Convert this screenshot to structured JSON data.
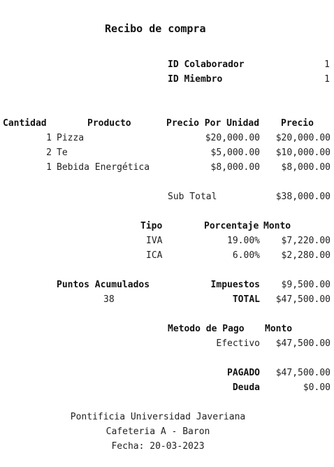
{
  "receipt": {
    "title": "Recibo de compra",
    "ids": [
      {
        "label": "ID Colaborador",
        "value": "1"
      },
      {
        "label": "ID Miembro",
        "value": "1"
      }
    ],
    "items_header": {
      "qty": "Cantidad",
      "product": "Producto",
      "unit_price": "Precio Por Unidad",
      "price": "Precio"
    },
    "items": [
      {
        "qty": "1",
        "product": "Pizza",
        "unit_price": "$20,000.00",
        "price": "$20,000.00"
      },
      {
        "qty": "2",
        "product": "Te",
        "unit_price": "$5,000.00",
        "price": "$10,000.00"
      },
      {
        "qty": "1",
        "product": "Bebida Energética",
        "unit_price": "$8,000.00",
        "price": "$8,000.00"
      }
    ],
    "subtotal": {
      "label": "Sub Total",
      "value": "$38,000.00"
    },
    "tax_header": {
      "type": "Tipo",
      "percent": "Porcentaje",
      "amount": "Monto"
    },
    "taxes": [
      {
        "type": "IVA",
        "percent": "19.00%",
        "amount": "$7,220.00"
      },
      {
        "type": "ICA",
        "percent": "6.00%",
        "amount": "$2,280.00"
      }
    ],
    "points": {
      "label": "Puntos Acumulados",
      "value": "38"
    },
    "taxes_total": {
      "label": "Impuestos",
      "value": "$9,500.00"
    },
    "total": {
      "label": "TOTAL",
      "value": "$47,500.00"
    },
    "payment_header": {
      "method": "Metodo de Pago",
      "amount": "Monto"
    },
    "payment": {
      "method": "Efectivo",
      "amount": "$47,500.00"
    },
    "paid": {
      "label": "PAGADO",
      "value": "$47,500.00"
    },
    "debt": {
      "label": "Deuda",
      "value": "$0.00"
    },
    "footer": {
      "university": "Pontificia Universidad Javeriana",
      "cafeteria": "Cafeteria A - Baron",
      "date": "Fecha: 20-03-2023"
    }
  }
}
